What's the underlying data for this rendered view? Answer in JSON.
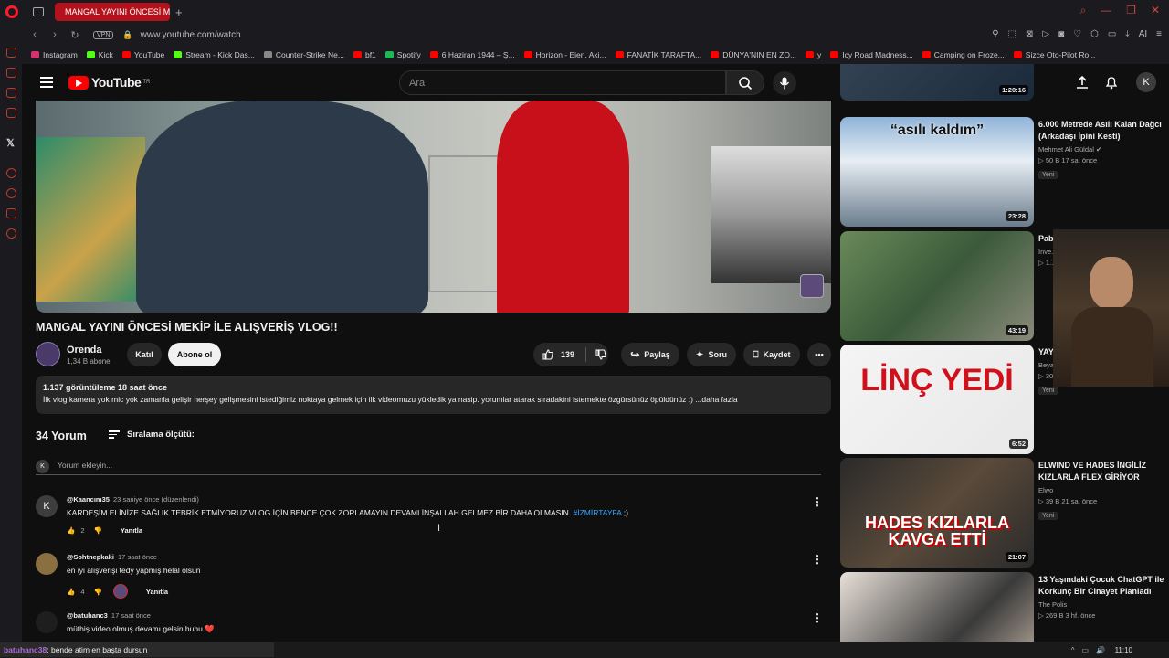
{
  "browser": {
    "tab_title": "MANGAL YAYINI ÖNCESİ M",
    "url": "www.youtube.com/watch",
    "vpn_label": "VPN"
  },
  "bookmarks": [
    {
      "label": "Instagram",
      "color": "#d6336c"
    },
    {
      "label": "Kick",
      "color": "#53fc18"
    },
    {
      "label": "YouTube",
      "color": "#ff0000"
    },
    {
      "label": "Stream - Kick Das...",
      "color": "#53fc18"
    },
    {
      "label": "Counter-Strike Ne...",
      "color": "#888888"
    },
    {
      "label": "bf1",
      "color": "#ff0000"
    },
    {
      "label": "Spotify",
      "color": "#1db954"
    },
    {
      "label": "6 Haziran 1944 – Ş...",
      "color": "#ff0000"
    },
    {
      "label": "Horizon - Eien, Aki...",
      "color": "#ff0000"
    },
    {
      "label": "FANATİK TARAFTA...",
      "color": "#ff0000"
    },
    {
      "label": "DÜNYA'NIN EN ZO...",
      "color": "#ff0000"
    },
    {
      "label": "y",
      "color": "#ff0000"
    },
    {
      "label": "Icy Road Madness...",
      "color": "#ff0000"
    },
    {
      "label": "Camping on Froze...",
      "color": "#ff0000"
    },
    {
      "label": "Sizce Oto-Pilot Ro...",
      "color": "#ff0000"
    }
  ],
  "header": {
    "logo_text": "YouTube",
    "logo_region": "TR",
    "search_placeholder": "Ara",
    "avatar_letter": "K"
  },
  "video": {
    "title": "MANGAL YAYINI ÖNCESİ MEKİP İLE ALIŞVERİŞ VLOG!!",
    "channel": "Orenda",
    "subscribers": "1,34 B abone",
    "join_label": "Katıl",
    "subscribe_label": "Abone ol",
    "likes": "139",
    "share_label": "Paylaş",
    "ask_label": "Soru",
    "save_label": "Kaydet",
    "views_date": "1.137 görüntüleme  18 saat önce",
    "description": "İlk vlog kamera yok mic yok zamanla gelişir herşey gelişmesini istediğimiz noktaya gelmek için ilk videomuzu yükledik ya nasip. yorumlar atarak sıradakini istemekte özgürsünüz öpüldünüz :) ...daha fazla"
  },
  "comments": {
    "count_label": "34 Yorum",
    "sort_label": "Sıralama ölçütü:",
    "add_placeholder": "Yorum ekleyin...",
    "my_avatar": "K",
    "items": [
      {
        "author": "@Kaancım35",
        "time": "23 saniye önce (düzenlendi)",
        "text": "KARDEŞİM ELİNİZE SAĞLIK TEBRİK ETMİYORUZ VLOG İÇİN BENCE ÇOK ZORLAMAYIN DEVAMI İNŞALLAH GELMEZ BİR DAHA OLMASIN.",
        "tag": "#İZMİRTAYFA",
        "suffix": " ;)",
        "likes": "2",
        "reply": "Yanıtla",
        "avatar_letter": "K",
        "avatar_color": "#3d3d3d"
      },
      {
        "author": "@Sohtnepkaki",
        "time": "17 saat önce",
        "text": "en iyi alışverişi tedy yapmış helal olsun",
        "tag": "",
        "suffix": "",
        "likes": "4",
        "reply": "Yanıtla",
        "avatar_letter": "",
        "avatar_color": "#8a7040"
      },
      {
        "author": "@batuhanc3",
        "time": "17 saat önce",
        "text": "müthiş video olmuş devamı gelsin huhu ❤️",
        "tag": "",
        "suffix": "",
        "likes": "",
        "reply": "",
        "avatar_letter": "",
        "avatar_color": "#1e1e1e"
      }
    ]
  },
  "recommendations": [
    {
      "title": "",
      "channel": "",
      "meta": "",
      "badge": "",
      "duration": "1:20:16"
    },
    {
      "title": "6.000 Metrede Asılı Kalan Dağcı (Arkadaşı İpini Kesti)",
      "channel": "Mehmet Ali Güldal ✔",
      "meta": "▷ 50 B   17 sa. önce",
      "badge": "Yeni",
      "duration": "23:28",
      "thumb_text": "“asılı kaldım”"
    },
    {
      "title": "Pab... çok... kan...",
      "channel": "Inve...",
      "meta": "▷ 1...",
      "badge": "",
      "duration": "43:19"
    },
    {
      "title": "YAYINCI ERAY AĞIR LİNÇ YEDİ",
      "channel": "Beyaz Kurt ✔",
      "meta": "▷ 304 B   4 gün önce",
      "badge": "Yeni",
      "duration": "6:52",
      "thumb_text": "LİNÇ YEDİ"
    },
    {
      "title": "ELWIND VE HADES İNGİLİZ KIZLARLA FLEX GİRİYOR",
      "channel": "Elwo",
      "meta": "▷ 39 B   21 sa. önce",
      "badge": "Yeni",
      "duration": "21:07",
      "thumb_text": "HADES KIZLARLA KAVGA ETTİ"
    },
    {
      "title": "13 Yaşındaki Çocuk ChatGPT ile Korkunç Bir Cinayet Planladı",
      "channel": "The Polis",
      "meta": "▷ 269 B   3 hf. önce",
      "badge": "",
      "duration": ""
    }
  ],
  "taskbar": {
    "chat_user": "batuhanc38",
    "chat_message": ": bende atim en başta dursun",
    "clock": "11:10"
  },
  "colors": {
    "accent": "#ff0000",
    "tab_red": "#b3121c",
    "link_blue": "#3ea6ff"
  }
}
